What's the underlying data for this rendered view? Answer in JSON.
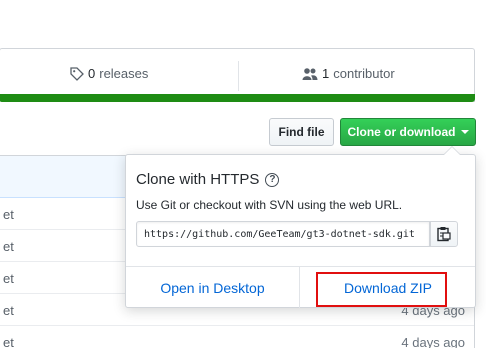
{
  "stats": {
    "releases_count": "0",
    "releases_label": "releases",
    "contributors_count": "1",
    "contributors_label": "contributor"
  },
  "toolbar": {
    "find_file_label": "Find file",
    "clone_label": "Clone or download"
  },
  "clone_popover": {
    "title": "Clone with HTTPS",
    "description": "Use Git or checkout with SVN using the web URL.",
    "url": "https://github.com/GeeTeam/gt3-dotnet-sdk.git",
    "open_desktop_label": "Open in Desktop",
    "download_zip_label": "Download ZIP"
  },
  "files": [
    {
      "name": "et",
      "age": ""
    },
    {
      "name": "et",
      "age": ""
    },
    {
      "name": "et",
      "age": ""
    },
    {
      "name": "et",
      "age": "4 days ago"
    },
    {
      "name": "et",
      "age": "4 days ago"
    }
  ],
  "colors": {
    "language_bar": "#1e8c14",
    "clone_button": "#28a745",
    "link": "#0366d6",
    "highlight": "#e10f0f"
  },
  "icons": {
    "releases": "tag-icon",
    "contributors": "people-icon",
    "help": "question-icon",
    "copy": "clipboard-icon"
  }
}
